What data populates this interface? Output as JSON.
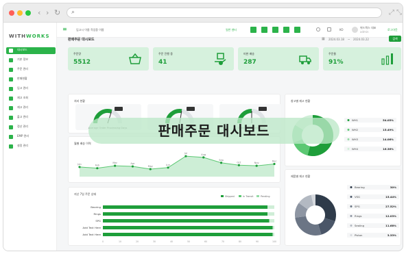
{
  "browser": {
    "url_search_icon": "search-icon"
  },
  "sidebar": {
    "logo_a": "WITH",
    "logo_b": "WORKS",
    "items": [
      "대시보드",
      "기본 정보",
      "주문 관리",
      "판매현황",
      "입고 관리",
      "재고 조회",
      "재고 관리",
      "출고 관리",
      "정산 관리",
      "EMP 관리",
      "설정 관리"
    ]
  },
  "topbar": {
    "breadcrumb": "입고시 이름 작업중 이름",
    "warehouse": "일반 센터",
    "lang": "KO",
    "user_name": "위드웍스 대표",
    "user_role": "admin",
    "logout": "로그아웃"
  },
  "main": {
    "title": "판매주문 대시보드",
    "date_from": "2024.03.18",
    "date_sep": "~",
    "date_to": "2024.03.22",
    "search_label": "검색"
  },
  "kpis": [
    {
      "label": "주문량",
      "value": "5512"
    },
    {
      "label": "주문 진행 중",
      "value": "41"
    },
    {
      "label": "미완 배송",
      "value": "287"
    },
    {
      "label": "주문율",
      "value": "91%"
    }
  ],
  "gauges": {
    "title": "처리 현황",
    "items": [
      {
        "label": "Average Order Processing Days",
        "level": 0.6
      },
      {
        "label": "Average Shipping Time",
        "level": 0.55
      },
      {
        "label": "Order Fulfillment Days",
        "level": 0.5
      }
    ]
  },
  "line_chart": {
    "title": "월별 배송 이력",
    "x": [
      "Jan",
      "Feb",
      "Mar",
      "Apr",
      "May",
      "Jun",
      "Jul",
      "Aug",
      "Sep",
      "Oct",
      "Nov",
      "Dec"
    ],
    "y": [
      32,
      28,
      36,
      34,
      25,
      30,
      68,
      64,
      46,
      38,
      36,
      42
    ],
    "ylim": [
      0,
      100
    ]
  },
  "bar_chart": {
    "title": "지난 7일 주문 상태",
    "legend": [
      "Shipped",
      "In Transit",
      "Pending"
    ],
    "rows": [
      {
        "label": "Bearing",
        "value": 96
      },
      {
        "label": "Rings",
        "value": 96
      },
      {
        "label": "SPG",
        "value": 97
      },
      {
        "label": "Add Text Here",
        "value": 99
      },
      {
        "label": "Add Text Here",
        "value": 99
      }
    ]
  },
  "donut1": {
    "title": "창고별 재고 현황",
    "items": [
      {
        "label": "WH1",
        "value": "54.05%",
        "color": "#1e9e3a"
      },
      {
        "label": "WH2",
        "value": "15.49%",
        "color": "#5cc873"
      },
      {
        "label": "WH3",
        "value": "14.06%",
        "color": "#94dba5"
      },
      {
        "label": "WH4",
        "value": "16.36%",
        "color": "#cfeed7"
      }
    ]
  },
  "donut2": {
    "title": "제품별 재고 현황",
    "items": [
      {
        "label": "Bearing",
        "value": "30%",
        "color": "#2f3b4a"
      },
      {
        "label": "VSG",
        "value": "15.44%",
        "color": "#4a5668"
      },
      {
        "label": "SPG",
        "value": "27.52%",
        "color": "#6b7585"
      },
      {
        "label": "Rings",
        "value": "12.03%",
        "color": "#8e96a3"
      },
      {
        "label": "Sealing",
        "value": "11.68%",
        "color": "#b3b9c2"
      },
      {
        "label": "Piston",
        "value": "3.33%",
        "color": "#d6d9de"
      }
    ]
  },
  "overlay": {
    "text": "판매주문 대시보드"
  },
  "colors": {
    "accent": "#2bb34a",
    "accent_dark": "#1e9e3a",
    "kpi_bg": "#d6f1dd"
  }
}
